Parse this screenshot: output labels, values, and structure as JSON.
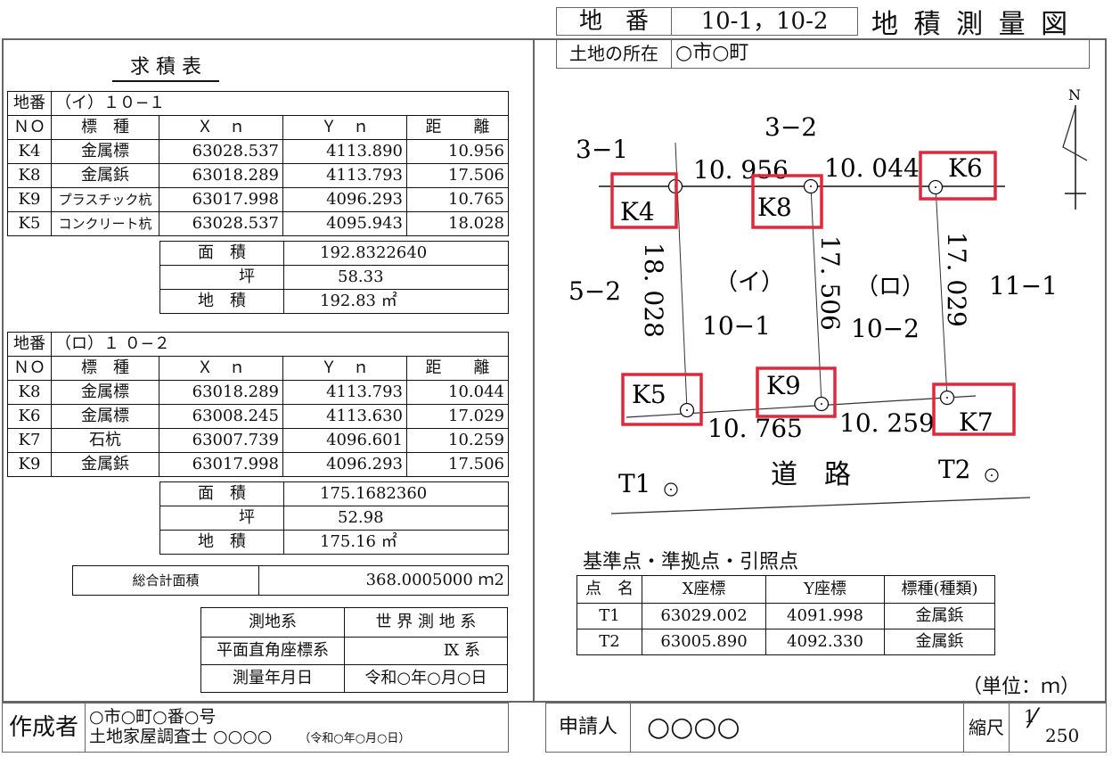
{
  "header": {
    "lot_label": "地　番",
    "lot_value": "10-1，10-2",
    "doc_title": "地 積 測 量 図",
    "location_label": "土地の所在",
    "location_value": "○市○町"
  },
  "area_table_title": "求 積 表",
  "parcel_a": {
    "lot_label": "地番",
    "lot_value": "（イ）１０−１",
    "columns": [
      "ＮＯ",
      "標　種",
      "Ｘ　ｎ",
      "Ｙ　ｎ",
      "距　　離"
    ],
    "rows": [
      {
        "no": "K4",
        "type": "金属標",
        "x": "63028.537",
        "y": "4113.890",
        "dist": "10.956"
      },
      {
        "no": "K8",
        "type": "金属鋲",
        "x": "63018.289",
        "y": "4113.793",
        "dist": "17.506"
      },
      {
        "no": "K9",
        "type": "プラスチック杭",
        "x": "63017.998",
        "y": "4096.293",
        "dist": "10.765"
      },
      {
        "no": "K5",
        "type": "コンクリート杭",
        "x": "63028.537",
        "y": "4095.943",
        "dist": "18.028"
      }
    ],
    "summary": [
      {
        "label": "面　積",
        "value": "192.8322640"
      },
      {
        "label": "坪",
        "value": "58.33"
      },
      {
        "label": "地　積",
        "value": "192.83 ㎡"
      }
    ]
  },
  "parcel_b": {
    "lot_label": "地番",
    "lot_value": "（ロ）１ ０−２",
    "columns": [
      "ＮＯ",
      "標　種",
      "Ｘ　ｎ",
      "Ｙ　ｎ",
      "距　　離"
    ],
    "rows": [
      {
        "no": "K8",
        "type": "金属標",
        "x": "63018.289",
        "y": "4113.793",
        "dist": "10.044"
      },
      {
        "no": "K6",
        "type": "金属標",
        "x": "63008.245",
        "y": "4113.630",
        "dist": "17.029"
      },
      {
        "no": "K7",
        "type": "石杭",
        "x": "63007.739",
        "y": "4096.601",
        "dist": "10.259"
      },
      {
        "no": "K9",
        "type": "金属鋲",
        "x": "63017.998",
        "y": "4096.293",
        "dist": "17.506"
      }
    ],
    "summary": [
      {
        "label": "面　積",
        "value": "175.1682360"
      },
      {
        "label": "坪",
        "value": "52.98"
      },
      {
        "label": "地　積",
        "value": "175.16 ㎡"
      }
    ]
  },
  "total": {
    "label": "総合計面積",
    "value": "368.0005000 ｍ2"
  },
  "survey_info": [
    {
      "label": "測地系",
      "value": "世 界 測 地 系"
    },
    {
      "label": "平面直角座標系",
      "value": "Ⅸ 系"
    },
    {
      "label": "測量年月日",
      "value": "令和○年○月○日"
    }
  ],
  "footer": {
    "author_label": "作成者",
    "author_address": "○市○町○番○号",
    "author_name": "土地家屋調査士 ○○○○",
    "author_date": "（令和○年○月○日）",
    "applicant_label": "申請人",
    "applicant_value": "○○○○",
    "scale_label": "縮尺",
    "scale_num": "1",
    "scale_den": "250"
  },
  "plan": {
    "north_label": "N",
    "neighbors": [
      "3−1",
      "3−2",
      "5−2",
      "11−1"
    ],
    "parcels": [
      {
        "mark": "（イ）",
        "lot": "10−1"
      },
      {
        "mark": "（ロ）",
        "lot": "10−2"
      }
    ],
    "distances": {
      "k4_k8": "10. 956",
      "k8_k6": "10. 044",
      "k4_k5": "18. 028",
      "k8_k9": "17. 506",
      "k6_k7": "17. 029",
      "k5_k9": "10. 765",
      "k9_k7": "10. 259"
    },
    "points": [
      "K4",
      "K8",
      "K6",
      "K5",
      "K9",
      "K7"
    ],
    "benchmarks": [
      "T1",
      "T2"
    ],
    "road_label": "道　路",
    "highlight_color": "#e0283c"
  },
  "reference_table": {
    "title": "基準点・準拠点・引照点",
    "columns": [
      "点　名",
      "X座標",
      "Y座標",
      "標種(種類)"
    ],
    "rows": [
      {
        "name": "T1",
        "x": "63029.002",
        "y": "4091.998",
        "type": "金属鋲"
      },
      {
        "name": "T2",
        "x": "63005.890",
        "y": "4092.330",
        "type": "金属鋲"
      }
    ]
  },
  "unit_note": "（単位：ｍ）"
}
